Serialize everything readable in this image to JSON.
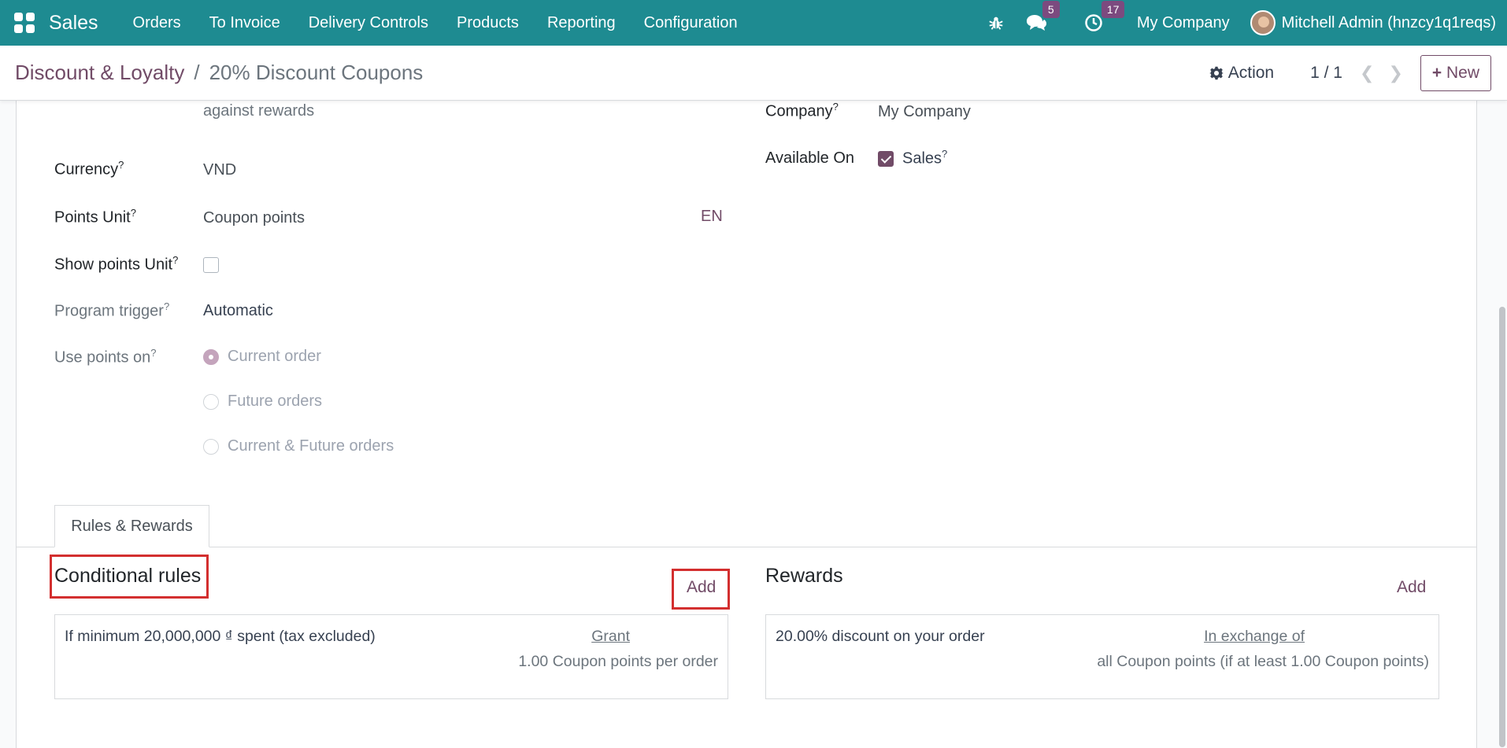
{
  "topnav": {
    "app_name": "Sales",
    "menu": [
      "Orders",
      "To Invoice",
      "Delivery Controls",
      "Products",
      "Reporting",
      "Configuration"
    ],
    "messages_count": "5",
    "activities_count": "17",
    "company": "My Company",
    "user": "Mitchell Admin (hnzcy1q1reqs)"
  },
  "control": {
    "breadcrumb_parent": "Discount & Loyalty",
    "breadcrumb_sep": "/",
    "breadcrumb_current": "20% Discount Coupons",
    "action_label": "Action",
    "pager": "1 / 1",
    "new_label": "New"
  },
  "form": {
    "description_cont": "against rewards",
    "currency_label": "Currency",
    "currency_value": "VND",
    "points_unit_label": "Points Unit",
    "points_unit_value": "Coupon points",
    "lang_code": "EN",
    "show_points_label": "Show points Unit",
    "program_trigger_label": "Program trigger",
    "program_trigger_value": "Automatic",
    "use_points_label": "Use points on",
    "use_points_options": [
      "Current order",
      "Future orders",
      "Current & Future orders"
    ],
    "company_label": "Company",
    "company_value": "My Company",
    "available_on_label": "Available On",
    "available_on_value": "Sales",
    "help_mark": "?"
  },
  "tabs": {
    "rules_rewards": "Rules & Rewards"
  },
  "rules": {
    "title": "Conditional rules",
    "add_label": "Add",
    "item_text": "If minimum 20,000,000 ₫ spent (tax excluded)",
    "item_link": "Grant",
    "item_sub": "1.00 Coupon points per order"
  },
  "rewards": {
    "title": "Rewards",
    "add_label": "Add",
    "item_text": "20.00% discount on your order",
    "item_link": "In exchange of",
    "item_sub": "all Coupon points (if at least 1.00 Coupon points)"
  },
  "colors": {
    "navbar": "#1e8b91",
    "accent": "#714b67",
    "highlight": "#d32f2f"
  }
}
